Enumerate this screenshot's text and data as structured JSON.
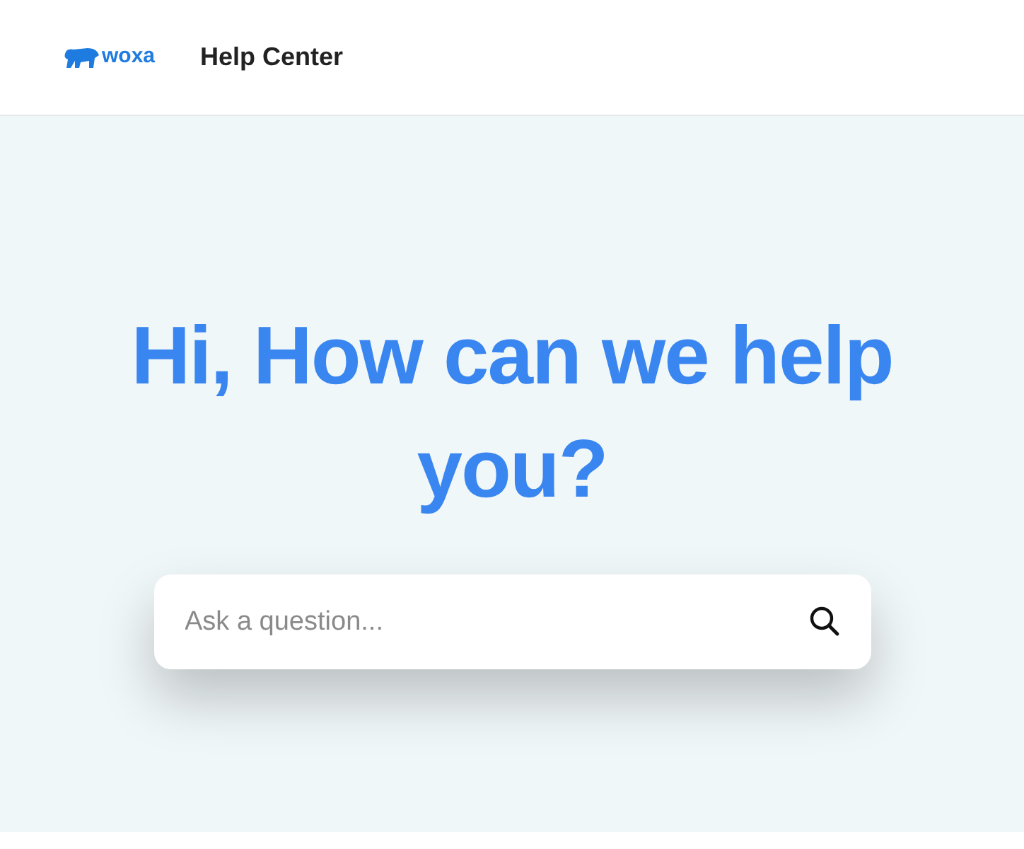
{
  "header": {
    "logo_text": "woxa",
    "title": "Help Center"
  },
  "hero": {
    "heading": "Hi, How can we help you?",
    "search": {
      "placeholder": "Ask a question..."
    }
  }
}
